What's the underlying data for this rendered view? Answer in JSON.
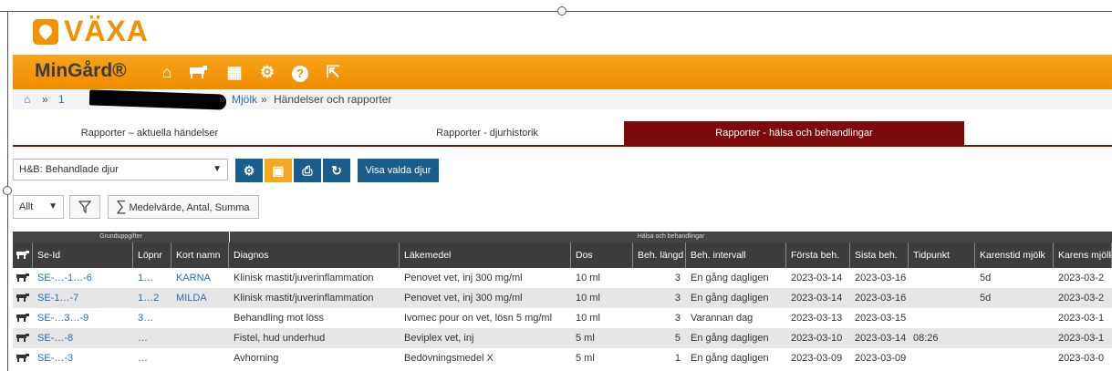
{
  "app": {
    "logo_text": "VÄXA",
    "brand": "MinGård®",
    "colors": {
      "orange": "#f39200",
      "dark_red": "#7d0a0a",
      "blue": "#1b5e8c",
      "header_dark": "#3d3d3d",
      "link": "#2a6db0"
    }
  },
  "nav": {
    "icons": [
      "home-icon",
      "cow-icon",
      "calendar-icon",
      "gear-icon",
      "help-icon",
      "external-link-icon"
    ],
    "glyphs": {
      "home": "⌂",
      "calendar": "▦",
      "gear": "⚙",
      "help": "?",
      "external": "⇱"
    }
  },
  "breadcrumb": {
    "sep": "»",
    "item1": "1",
    "item2": "Mjölk",
    "item3": "Händelser och rapporter"
  },
  "tabs": [
    {
      "label": "Rapporter – aktuella händelser",
      "active": false
    },
    {
      "label": "Rapporter - djurhistorik",
      "active": false
    },
    {
      "label": "Rapporter - hälsa och behandlingar",
      "active": true
    }
  ],
  "toolbar": {
    "report_select": "H&B: Behandlade djur",
    "show_selected_label": "Visa valda djur",
    "icon_glyphs": {
      "settings": "⚙",
      "save": "▣",
      "print": "⎙",
      "refresh": "↻"
    },
    "filter_select": "Allt",
    "aggregate_label": "Medelvärde, Antal, Summa"
  },
  "table": {
    "groups": [
      "Grunduppgifter",
      "Hälsa och behandlingar"
    ],
    "columns": [
      "Se-Id",
      "Löpnr",
      "Kort namn",
      "Diagnos",
      "Läkemedel",
      "Dos",
      "Beh. längd",
      "Beh. intervall",
      "Första beh.",
      "Sista beh.",
      "Tidpunkt",
      "Karenstid mjölk",
      "Karens mjölk"
    ],
    "rows": [
      {
        "seid": "SE-…-1…-6",
        "lopnr": "1…",
        "kortnamn": "KARNA",
        "diagnos": "Klinisk mastit/juverinflammation",
        "lakemedel": "Penovet vet, inj 300 mg/ml",
        "dos": "10 ml",
        "langd": "3",
        "intervall": "En gång dagligen",
        "forsta": "2023-03-14",
        "sista": "2023-03-16",
        "tidpunkt": "",
        "karenstid": "5d",
        "karens": "2023-03-2"
      },
      {
        "seid": "SE-1…-7",
        "lopnr": "1…2",
        "kortnamn": "MILDA",
        "diagnos": "Klinisk mastit/juverinflammation",
        "lakemedel": "Penovet vet, inj 300 mg/ml",
        "dos": "10 ml",
        "langd": "3",
        "intervall": "En gång dagligen",
        "forsta": "2023-03-14",
        "sista": "2023-03-16",
        "tidpunkt": "",
        "karenstid": "5d",
        "karens": "2023-03-2"
      },
      {
        "seid": "SE-…3…-9",
        "lopnr": "3…",
        "kortnamn": "",
        "diagnos": "Behandling mot löss",
        "lakemedel": "Ivomec pour on vet, lösn 5 mg/ml",
        "dos": "10 ml",
        "langd": "3",
        "intervall": "Varannan dag",
        "forsta": "2023-03-13",
        "sista": "2023-03-15",
        "tidpunkt": "",
        "karenstid": "",
        "karens": "2023-03-1"
      },
      {
        "seid": "SE-…-8",
        "lopnr": "…",
        "kortnamn": "",
        "diagnos": "Fistel, hud underhud",
        "lakemedel": "Beviplex vet, inj",
        "dos": "5 ml",
        "langd": "5",
        "intervall": "En gång dagligen",
        "forsta": "2023-03-10",
        "sista": "2023-03-14",
        "tidpunkt": "08:26",
        "karenstid": "",
        "karens": "2023-03-1"
      },
      {
        "seid": "SE-…-3",
        "lopnr": "…",
        "kortnamn": "",
        "diagnos": "Avhorning",
        "lakemedel": "Bedövningsmedel X",
        "dos": "5 ml",
        "langd": "1",
        "intervall": "En gång dagligen",
        "forsta": "2023-03-09",
        "sista": "2023-03-09",
        "tidpunkt": "",
        "karenstid": "",
        "karens": "2023-03-0"
      }
    ]
  }
}
